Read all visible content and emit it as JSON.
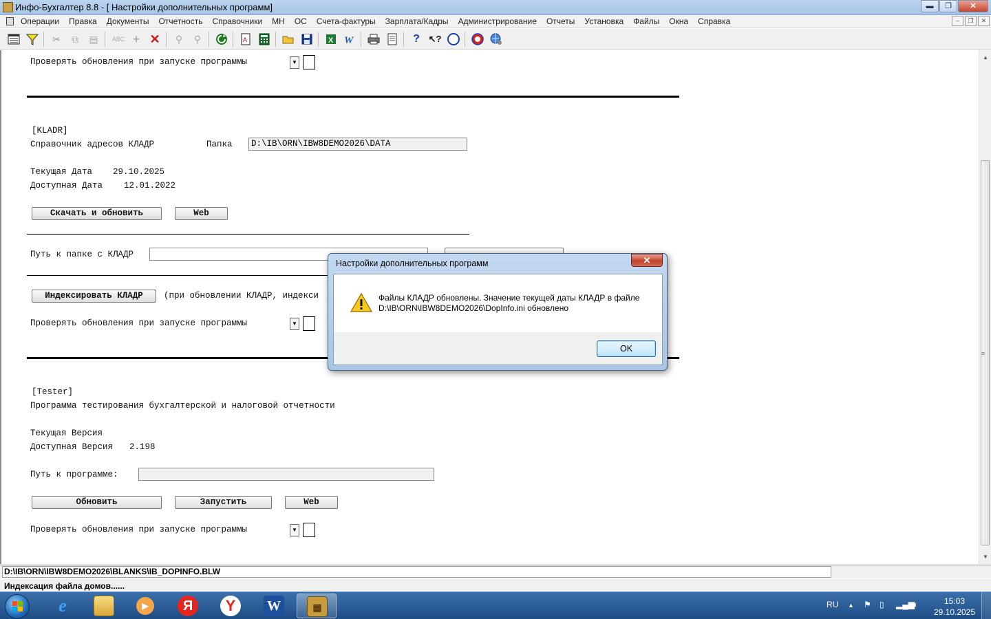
{
  "window": {
    "title": "Инфо-Бухгалтер 8.8 - [ Настройки дополнительных программ]",
    "minimize": "▬",
    "maximize": "❐",
    "close": "✕"
  },
  "menu": {
    "items": [
      "Операции",
      "Правка",
      "Документы",
      "Отчетность",
      "Справочники",
      "МН",
      "ОС",
      "Счета-фактуры",
      "Зарплата/Кадры",
      "Администрирование",
      "Отчеты",
      "Установка",
      "Файлы",
      "Окна",
      "Справка"
    ],
    "mdi": [
      "–",
      "❐",
      "✕"
    ]
  },
  "top_section": {
    "check_label": "Проверять обновления при запуске программы"
  },
  "kladr": {
    "header": "[KLADR]",
    "name": "Справочник адресов КЛАДР",
    "folder_label": "Папка",
    "folder_value": "D:\\IB\\ORN\\IBW8DEMO2026\\DATA",
    "current_date_label": "Текущая Дата",
    "current_date": "29.10.2025",
    "available_date_label": "Доступная Дата",
    "available_date": "12.01.2022",
    "download_button": "Скачать и обновить",
    "web_button": "Web",
    "path_label": "Путь к папке с КЛАДР",
    "path_value": "",
    "index_button": "Индексировать КЛАДР",
    "index_note": "(при обновлении КЛАДР, индекси",
    "check_label": "Проверять обновления при запуске программы"
  },
  "tester": {
    "header": "[Tester]",
    "name": "Программа тестирования бухгалтерской и налоговой отчетности",
    "current_version_label": "Текущая Версия",
    "current_version": "",
    "available_version_label": "Доступная Версия",
    "available_version": "2.198",
    "path_label": "Путь к программе:",
    "path_value": "",
    "update_button": "Обновить",
    "run_button": "Запустить",
    "web_button": "Web",
    "check_label": "Проверять обновления при запуске программы"
  },
  "status": {
    "path": "D:\\IB\\ORN\\IBW8DEMO2026\\BLANKS\\IB_DOPINFO.BLW",
    "message": "Индексация файла домов......"
  },
  "dialog": {
    "title": "Настройки дополнительных программ",
    "line1": "Файлы КЛАДР обновлены. Значение текущей даты КЛАДР в файле",
    "line2": "D:\\IB\\ORN\\IBW8DEMO2026\\DopInfo.ini обновлено",
    "ok": "OK",
    "close": "✕"
  },
  "taskbar": {
    "lang": "RU",
    "time": "15:03",
    "date": "29.10.2025"
  },
  "colors": {
    "title_bar": "#a5c3e6",
    "taskbar": "#1f4d86",
    "dialog_frame": "#a9c5e6"
  }
}
